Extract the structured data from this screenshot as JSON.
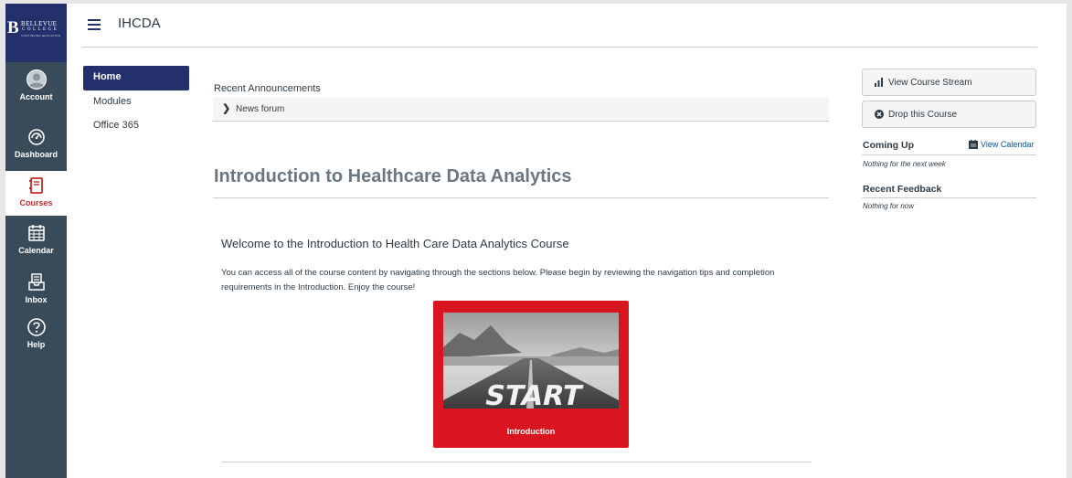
{
  "global_nav": {
    "logo": {
      "initial": "B",
      "line1": "BELLEVUE",
      "line2": "COLLEGE",
      "line3": "CONTINUING EDUCATION"
    },
    "items": [
      {
        "label": "Account",
        "icon": "account-icon"
      },
      {
        "label": "Dashboard",
        "icon": "dashboard-icon"
      },
      {
        "label": "Courses",
        "icon": "courses-icon",
        "active": true
      },
      {
        "label": "Calendar",
        "icon": "calendar-icon"
      },
      {
        "label": "Inbox",
        "icon": "inbox-icon"
      },
      {
        "label": "Help",
        "icon": "help-icon"
      }
    ]
  },
  "header": {
    "course_code": "IHCDA"
  },
  "course_nav": {
    "items": [
      {
        "label": "Home",
        "active": true
      },
      {
        "label": "Modules"
      },
      {
        "label": "Office 365"
      }
    ]
  },
  "main": {
    "announcements_label": "Recent Announcements",
    "forum_link": "News forum",
    "page_heading": "Introduction to Healthcare Data Analytics",
    "welcome_heading": "Welcome to the Introduction to Health Care Data Analytics Course",
    "body_text": "You can access all of the course content by navigating through the sections below. Please begin by reviewing the navigation tips and completion requirements in the Introduction. Enjoy the course!",
    "tile": {
      "image_text": "START",
      "label": "Introduction"
    }
  },
  "sidebar": {
    "view_stream": "View Course Stream",
    "drop_course": "Drop this Course",
    "coming_up": "Coming Up",
    "view_calendar": "View Calendar",
    "coming_up_empty": "Nothing for the next week",
    "recent_feedback": "Recent Feedback",
    "feedback_empty": "Nothing for now"
  },
  "colors": {
    "global_nav_bg": "#394b58",
    "brand_navy": "#23306b",
    "active_red": "#c72b29",
    "tile_red": "#d9161f"
  }
}
